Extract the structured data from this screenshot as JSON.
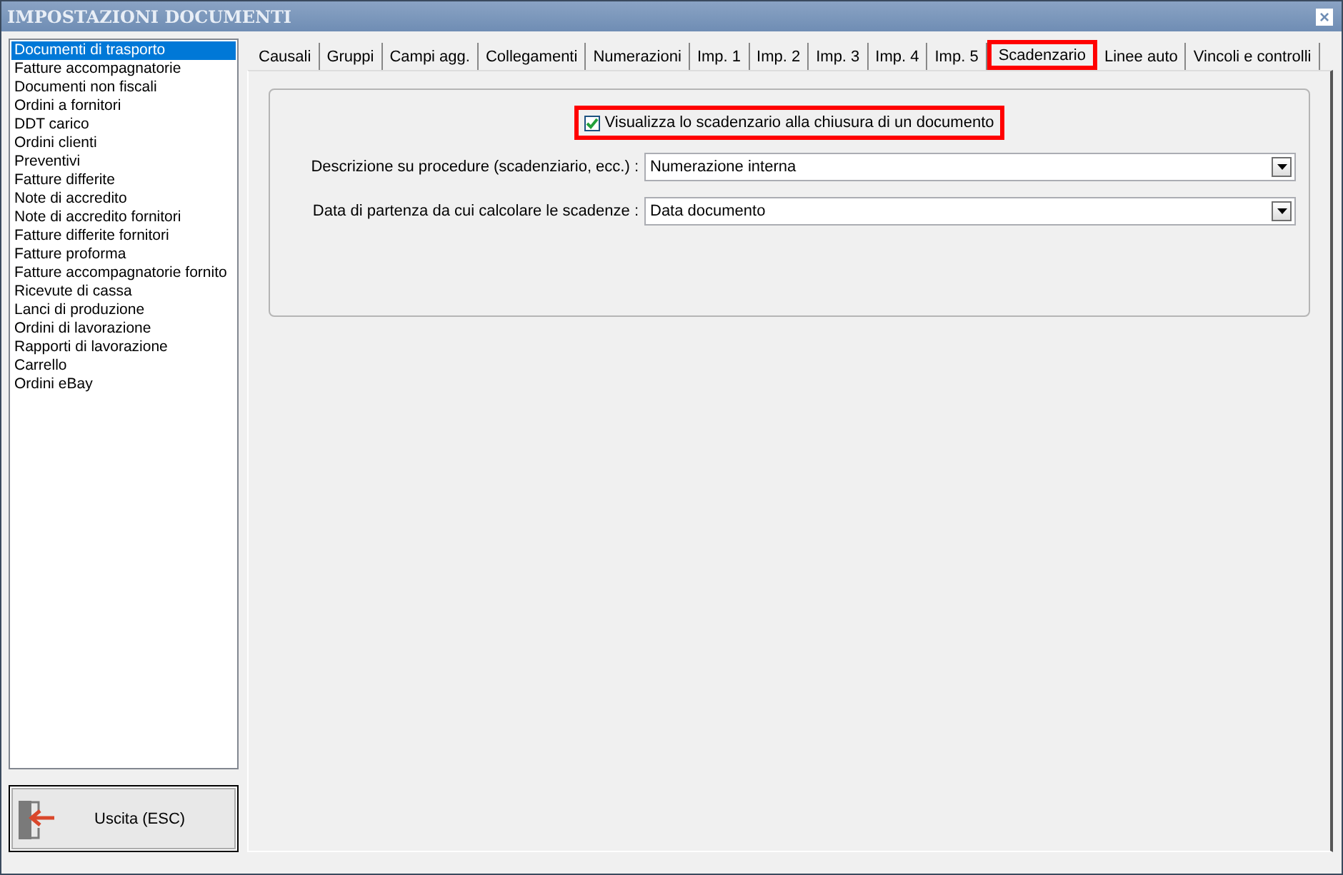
{
  "window": {
    "title": "IMPOSTAZIONI DOCUMENTI",
    "close": "×"
  },
  "sidebar": {
    "items": [
      {
        "label": "Documenti di trasporto",
        "selected": true
      },
      {
        "label": "Fatture accompagnatorie",
        "selected": false
      },
      {
        "label": "Documenti non fiscali",
        "selected": false
      },
      {
        "label": "Ordini a fornitori",
        "selected": false
      },
      {
        "label": "DDT carico",
        "selected": false
      },
      {
        "label": "Ordini clienti",
        "selected": false
      },
      {
        "label": "Preventivi",
        "selected": false
      },
      {
        "label": "Fatture differite",
        "selected": false
      },
      {
        "label": "Note di accredito",
        "selected": false
      },
      {
        "label": "Note di accredito fornitori",
        "selected": false
      },
      {
        "label": "Fatture differite fornitori",
        "selected": false
      },
      {
        "label": "Fatture proforma",
        "selected": false
      },
      {
        "label": "Fatture accompagnatorie fornito",
        "selected": false
      },
      {
        "label": "Ricevute di cassa",
        "selected": false
      },
      {
        "label": "Lanci di produzione",
        "selected": false
      },
      {
        "label": "Ordini di lavorazione",
        "selected": false
      },
      {
        "label": "Rapporti di lavorazione",
        "selected": false
      },
      {
        "label": "Carrello",
        "selected": false
      },
      {
        "label": "Ordini eBay",
        "selected": false
      }
    ]
  },
  "exit_button": {
    "label": "Uscita (ESC)"
  },
  "tabs": [
    {
      "label": "Causali",
      "selected": false,
      "highlighted": false
    },
    {
      "label": "Gruppi",
      "selected": false,
      "highlighted": false
    },
    {
      "label": "Campi agg.",
      "selected": false,
      "highlighted": false
    },
    {
      "label": "Collegamenti",
      "selected": false,
      "highlighted": false
    },
    {
      "label": "Numerazioni",
      "selected": false,
      "highlighted": false
    },
    {
      "label": "Imp. 1",
      "selected": false,
      "highlighted": false
    },
    {
      "label": "Imp. 2",
      "selected": false,
      "highlighted": false
    },
    {
      "label": "Imp. 3",
      "selected": false,
      "highlighted": false
    },
    {
      "label": "Imp. 4",
      "selected": false,
      "highlighted": false
    },
    {
      "label": "Imp. 5",
      "selected": false,
      "highlighted": false
    },
    {
      "label": "Scadenzario",
      "selected": true,
      "highlighted": true
    },
    {
      "label": "Linee auto",
      "selected": false,
      "highlighted": false
    },
    {
      "label": "Vincoli e controlli",
      "selected": false,
      "highlighted": false
    }
  ],
  "settings": {
    "checkbox": {
      "label": "Visualizza lo scadenzario alla chiusura di un documento",
      "checked": true,
      "highlighted": true
    },
    "fields": [
      {
        "label": "Descrizione su procedure (scadenziario, ecc.) :",
        "value": "Numerazione interna"
      },
      {
        "label": "Data di partenza da cui calcolare le scadenze :",
        "value": "Data documento"
      }
    ]
  }
}
